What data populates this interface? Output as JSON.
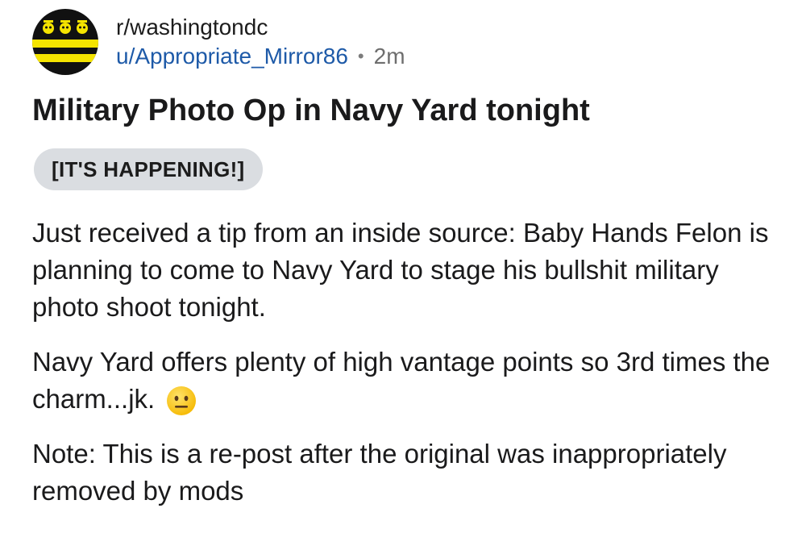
{
  "post": {
    "subreddit": "r/washingtondc",
    "username": "u/Appropriate_Mirror86",
    "separator": "•",
    "time_ago": "2m",
    "title": "Military Photo Op in Navy Yard tonight",
    "flair": "[IT'S HAPPENING!]",
    "body": {
      "para1": "Just received a tip from an inside source: Baby Hands Felon is planning to come to Navy Yard to stage his bullshit military photo shoot tonight.",
      "para2": "Navy Yard offers plenty of high vantage points so 3rd times the charm...jk.",
      "para3": "Note: This is a re-post after the original was inappropriately removed by mods"
    }
  },
  "icons": {
    "subreddit_avatar": "dc-flag-avatar-icon",
    "emoji": "neutral-face-emoji-icon"
  },
  "colors": {
    "username": "#1e5aa8",
    "flair_bg": "#dadde1",
    "avatar_stripe": "#f5e400",
    "avatar_base": "#111111"
  }
}
